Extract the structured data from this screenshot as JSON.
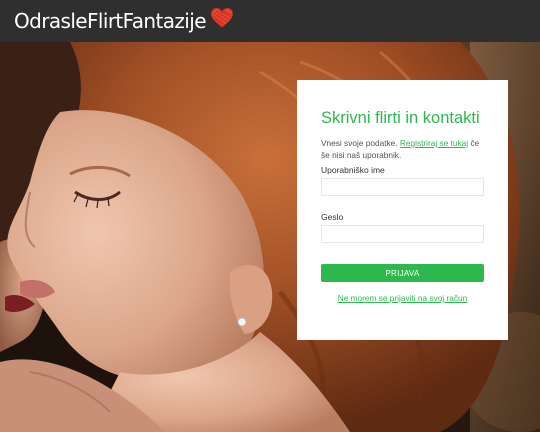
{
  "header": {
    "logo_text": "OdrasleFlirtFantazije",
    "logo_icon": "heart-icon",
    "accent_color": "#e8432d"
  },
  "hero": {
    "image_description_icon": "photo-background"
  },
  "login": {
    "title": "Skrivni flirti in kontakti",
    "intro_before": "Vnesi svoje podatke.",
    "register_link": "Registriraj se tukaj",
    "intro_after": "če še nisi naš uporabnik.",
    "username_label": "Uporabniško ime",
    "username_value": "",
    "password_label": "Geslo",
    "password_value": "",
    "submit_label": "PRIJAVA",
    "forgot_link": "Ne morem se prijaviti na svoj račun",
    "accent_color": "#2db84d"
  }
}
